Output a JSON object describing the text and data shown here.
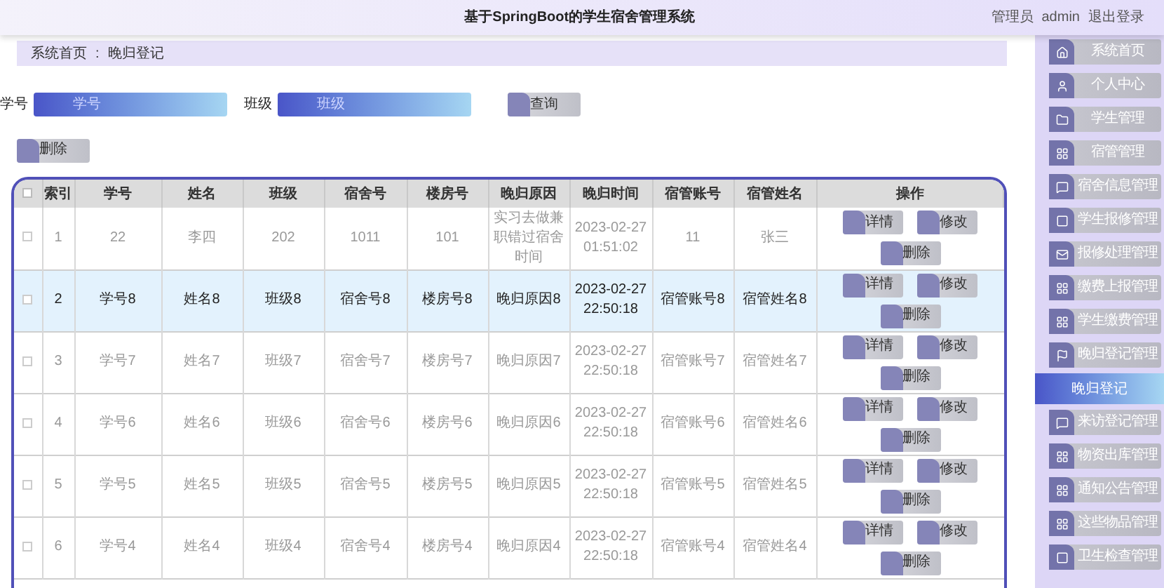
{
  "header": {
    "title": "基于SpringBoot的学生宿舍管理系统",
    "role": "管理员",
    "user": "admin",
    "logout": "退出登录"
  },
  "breadcrumb": {
    "home": "系统首页",
    "separator": ":",
    "current": "晚归登记"
  },
  "search": [
    {
      "label": "学号",
      "placeholder": "学号"
    },
    {
      "label": "班级",
      "placeholder": "班级"
    }
  ],
  "query_button": "查询",
  "delete_button": "删除",
  "table": {
    "columns": [
      "索引",
      "学号",
      "姓名",
      "班级",
      "宿舍号",
      "楼房号",
      "晚归原因",
      "晚归时间",
      "宿管账号",
      "宿管姓名",
      "操作"
    ],
    "header_checked": false,
    "rows": [
      {
        "selected": false,
        "checked": false,
        "cells": [
          "1",
          "22",
          "李四",
          "202",
          "1011",
          "101",
          "实习去做兼职错过宿舍时间",
          "2023-02-27 01:51:02",
          "11",
          "张三"
        ],
        "actions": [
          "详情",
          "修改",
          "删除"
        ]
      },
      {
        "selected": true,
        "checked": false,
        "cells": [
          "2",
          "学号8",
          "姓名8",
          "班级8",
          "宿舍号8",
          "楼房号8",
          "晚归原因8",
          "2023-02-27 22:50:18",
          "宿管账号8",
          "宿管姓名8"
        ],
        "actions": [
          "详情",
          "修改",
          "删除"
        ]
      },
      {
        "selected": false,
        "checked": false,
        "cells": [
          "3",
          "学号7",
          "姓名7",
          "班级7",
          "宿舍号7",
          "楼房号7",
          "晚归原因7",
          "2023-02-27 22:50:18",
          "宿管账号7",
          "宿管姓名7"
        ],
        "actions": [
          "详情",
          "修改",
          "删除"
        ]
      },
      {
        "selected": false,
        "checked": false,
        "cells": [
          "4",
          "学号6",
          "姓名6",
          "班级6",
          "宿舍号6",
          "楼房号6",
          "晚归原因6",
          "2023-02-27 22:50:18",
          "宿管账号6",
          "宿管姓名6"
        ],
        "actions": [
          "详情",
          "修改",
          "删除"
        ]
      },
      {
        "selected": false,
        "checked": false,
        "cells": [
          "5",
          "学号5",
          "姓名5",
          "班级5",
          "宿舍号5",
          "楼房号5",
          "晚归原因5",
          "2023-02-27 22:50:18",
          "宿管账号5",
          "宿管姓名5"
        ],
        "actions": [
          "详情",
          "修改",
          "删除"
        ]
      },
      {
        "selected": false,
        "checked": false,
        "cells": [
          "6",
          "学号4",
          "姓名4",
          "班级4",
          "宿舍号4",
          "楼房号4",
          "晚归原因4",
          "2023-02-27 22:50:18",
          "宿管账号4",
          "宿管姓名4"
        ],
        "actions": [
          "详情",
          "修改",
          "删除"
        ]
      }
    ]
  },
  "sidebar": [
    {
      "label": "系统首页",
      "selected": false
    },
    {
      "label": "个人中心",
      "selected": false
    },
    {
      "label": "学生管理",
      "selected": false
    },
    {
      "label": "宿管管理",
      "selected": false
    },
    {
      "label": "宿舍信息管理",
      "selected": false
    },
    {
      "label": "学生报修管理",
      "selected": false
    },
    {
      "label": "报修处理管理",
      "selected": false
    },
    {
      "label": "缴费上报管理",
      "selected": false
    },
    {
      "label": "学生缴费管理",
      "selected": false
    },
    {
      "label": "晚归登记管理",
      "selected": false
    },
    {
      "label": "晚归登记",
      "selected": true
    },
    {
      "label": "来访登记管理",
      "selected": false
    },
    {
      "label": "物资出库管理",
      "selected": false
    },
    {
      "label": "通知公告管理",
      "selected": false
    },
    {
      "label": "这些物品管理",
      "selected": false
    },
    {
      "label": "卫生检查管理",
      "selected": false
    }
  ]
}
